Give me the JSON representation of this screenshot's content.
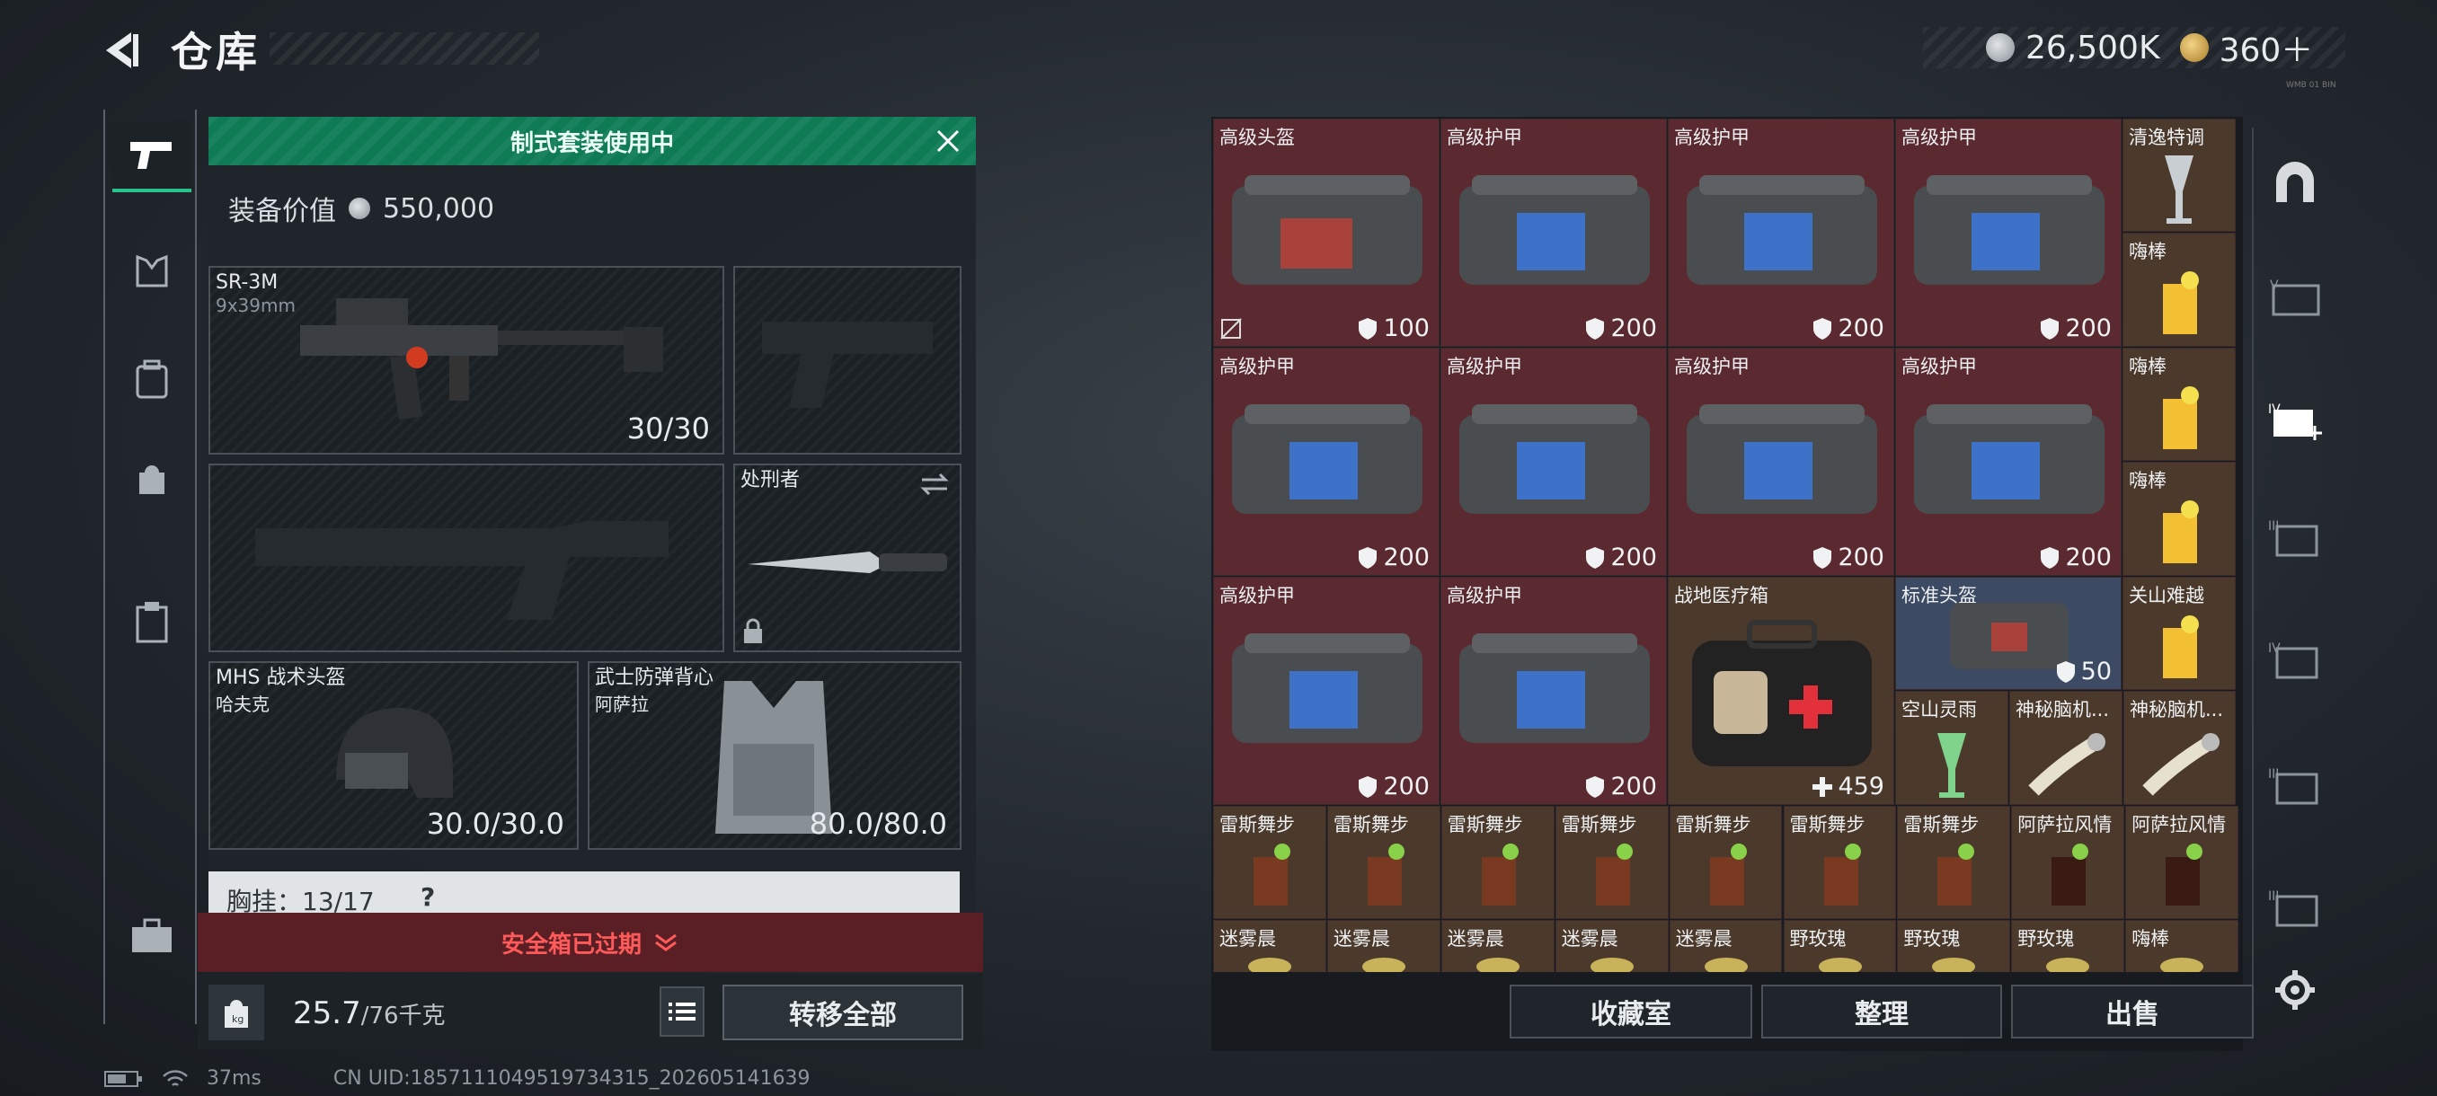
{
  "header": {
    "title": "仓库",
    "currency": [
      {
        "value": "26,500K",
        "color": "#c8ccd0"
      },
      {
        "value": "360＋",
        "color": "#d9b45a"
      }
    ],
    "build": "WMB 01 BIN"
  },
  "loadout": {
    "banner": "制式套装使用中",
    "equip_value_label": "装备价值",
    "equip_value": "550,000",
    "primary": {
      "name": "SR-3M",
      "ammo": "9x39mm",
      "count": "30/30"
    },
    "melee": {
      "name": "处刑者"
    },
    "helmet": {
      "name": "MHS 战术头盔",
      "sub": "哈夫克",
      "durability": "30.0/30.0"
    },
    "armor": {
      "name": "武士防弹背心",
      "sub": "阿萨拉",
      "durability": "80.0/80.0"
    },
    "chest_rig": "胸挂：13/17",
    "chest_rig_help": "?",
    "safe_box": "安全箱已过期",
    "weight": "25.7",
    "weight_max": "/76千克",
    "transfer_all": "转移全部"
  },
  "status": {
    "latency": "37ms",
    "uid": "CN UID:1857111049519734315_202605141639"
  },
  "storage": {
    "row1": [
      {
        "name": "高级头盔",
        "dur": "100"
      },
      {
        "name": "高级护甲",
        "dur": "200"
      },
      {
        "name": "高级护甲",
        "dur": "200"
      },
      {
        "name": "高级护甲",
        "dur": "200"
      }
    ],
    "row2": [
      {
        "name": "高级护甲",
        "dur": "200"
      },
      {
        "name": "高级护甲",
        "dur": "200"
      },
      {
        "name": "高级护甲",
        "dur": "200"
      },
      {
        "name": "高级护甲",
        "dur": "200"
      }
    ],
    "row3": [
      {
        "name": "高级护甲",
        "dur": "200"
      },
      {
        "name": "高级护甲",
        "dur": "200"
      }
    ],
    "medkit": {
      "name": "战地医疗箱",
      "dur": "459"
    },
    "std_helmet": {
      "name": "标准头盔",
      "dur": "50"
    },
    "small_right": [
      "清逸特调",
      "嗨棒",
      "嗨棒",
      "嗨棒",
      "关山难越"
    ],
    "row_mid": [
      "空山灵雨",
      "神秘脑机...",
      "神秘脑机..."
    ],
    "row_drinks": [
      "雷斯舞步",
      "雷斯舞步",
      "雷斯舞步",
      "雷斯舞步",
      "雷斯舞步",
      "雷斯舞步",
      "雷斯舞步",
      "阿萨拉风情",
      "阿萨拉风情"
    ],
    "row_last": [
      "迷雾晨",
      "迷雾晨",
      "迷雾晨",
      "迷雾晨",
      "迷雾晨",
      "野玫瑰",
      "野玫瑰",
      "野玫瑰",
      "嗨棒"
    ]
  },
  "actions": {
    "collection": "收藏室",
    "sort": "整理",
    "sell": "出售"
  },
  "colors": {
    "accent_green": "#0e7b55",
    "item_red": "#5b2a30",
    "warn_red": "#ff5a5a"
  }
}
